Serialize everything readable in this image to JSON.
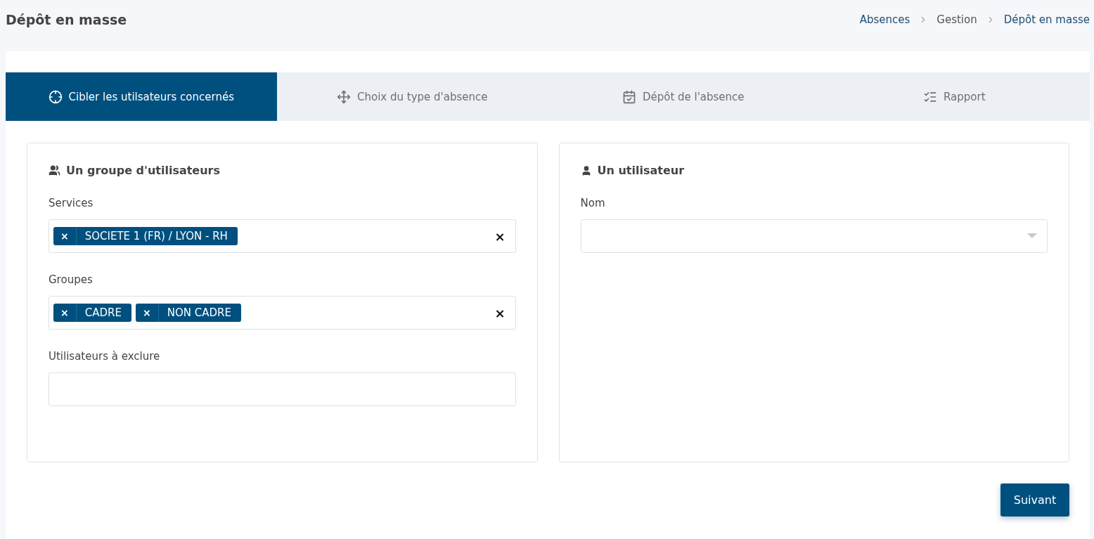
{
  "header": {
    "title": "Dépôt en masse"
  },
  "breadcrumb": [
    "Absences",
    "Gestion",
    "Dépôt en masse"
  ],
  "tabs": [
    {
      "label": "Cibler les utilsateurs concernés",
      "selected": true
    },
    {
      "label": "Choix du type d'absence",
      "selected": false
    },
    {
      "label": "Dépôt de l'absence",
      "selected": false
    },
    {
      "label": "Rapport",
      "selected": false
    }
  ],
  "panels": [
    {
      "kind": "group",
      "title": "Un groupe d'utilisateurs",
      "fields": [
        {
          "label": "Services",
          "kind": "multiselect",
          "clear": "×",
          "tags": [
            {
              "remove": "×",
              "label": "SOCIETE 1 (FR) / LYON - RH"
            }
          ]
        },
        {
          "label": "Groupes",
          "kind": "multiselect",
          "clear": "×",
          "tags": [
            {
              "remove": "×",
              "label": "CADRE"
            },
            {
              "remove": "×",
              "label": "NON CADRE"
            }
          ]
        },
        {
          "label": "Utilisateurs à exclure",
          "kind": "text"
        }
      ]
    },
    {
      "kind": "user",
      "title": "Un utilisateur",
      "fields": [
        {
          "label": "Nom",
          "kind": "select"
        }
      ]
    }
  ],
  "next_button": "Suivant"
}
